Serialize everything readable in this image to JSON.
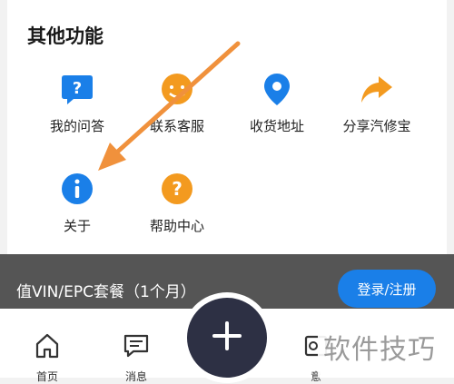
{
  "section": {
    "title": "其他功能"
  },
  "features": [
    {
      "label": "我的问答",
      "icon": "question-chat-icon",
      "color": "#1a7fe8"
    },
    {
      "label": "联系客服",
      "icon": "customer-service-icon",
      "color": "#f39a1f"
    },
    {
      "label": "收货地址",
      "icon": "location-pin-icon",
      "color": "#1a7fe8"
    },
    {
      "label": "分享汽修宝",
      "icon": "share-arrow-icon",
      "color": "#f39a1f"
    },
    {
      "label": "关于",
      "icon": "info-icon",
      "color": "#1a7fe8"
    },
    {
      "label": "帮助中心",
      "icon": "help-icon",
      "color": "#f39a1f"
    }
  ],
  "banner": {
    "text": "值VIN/EPC套餐（1个月）",
    "login_label": "登录/注册",
    "button_color": "#1a7fe8"
  },
  "nav": {
    "home_label": "首页",
    "messages_label": "消息",
    "right_label": "意",
    "fab_color": "#2d3044"
  },
  "watermark": {
    "text": "软件技巧"
  },
  "annotation": {
    "color": "#f0913c"
  }
}
